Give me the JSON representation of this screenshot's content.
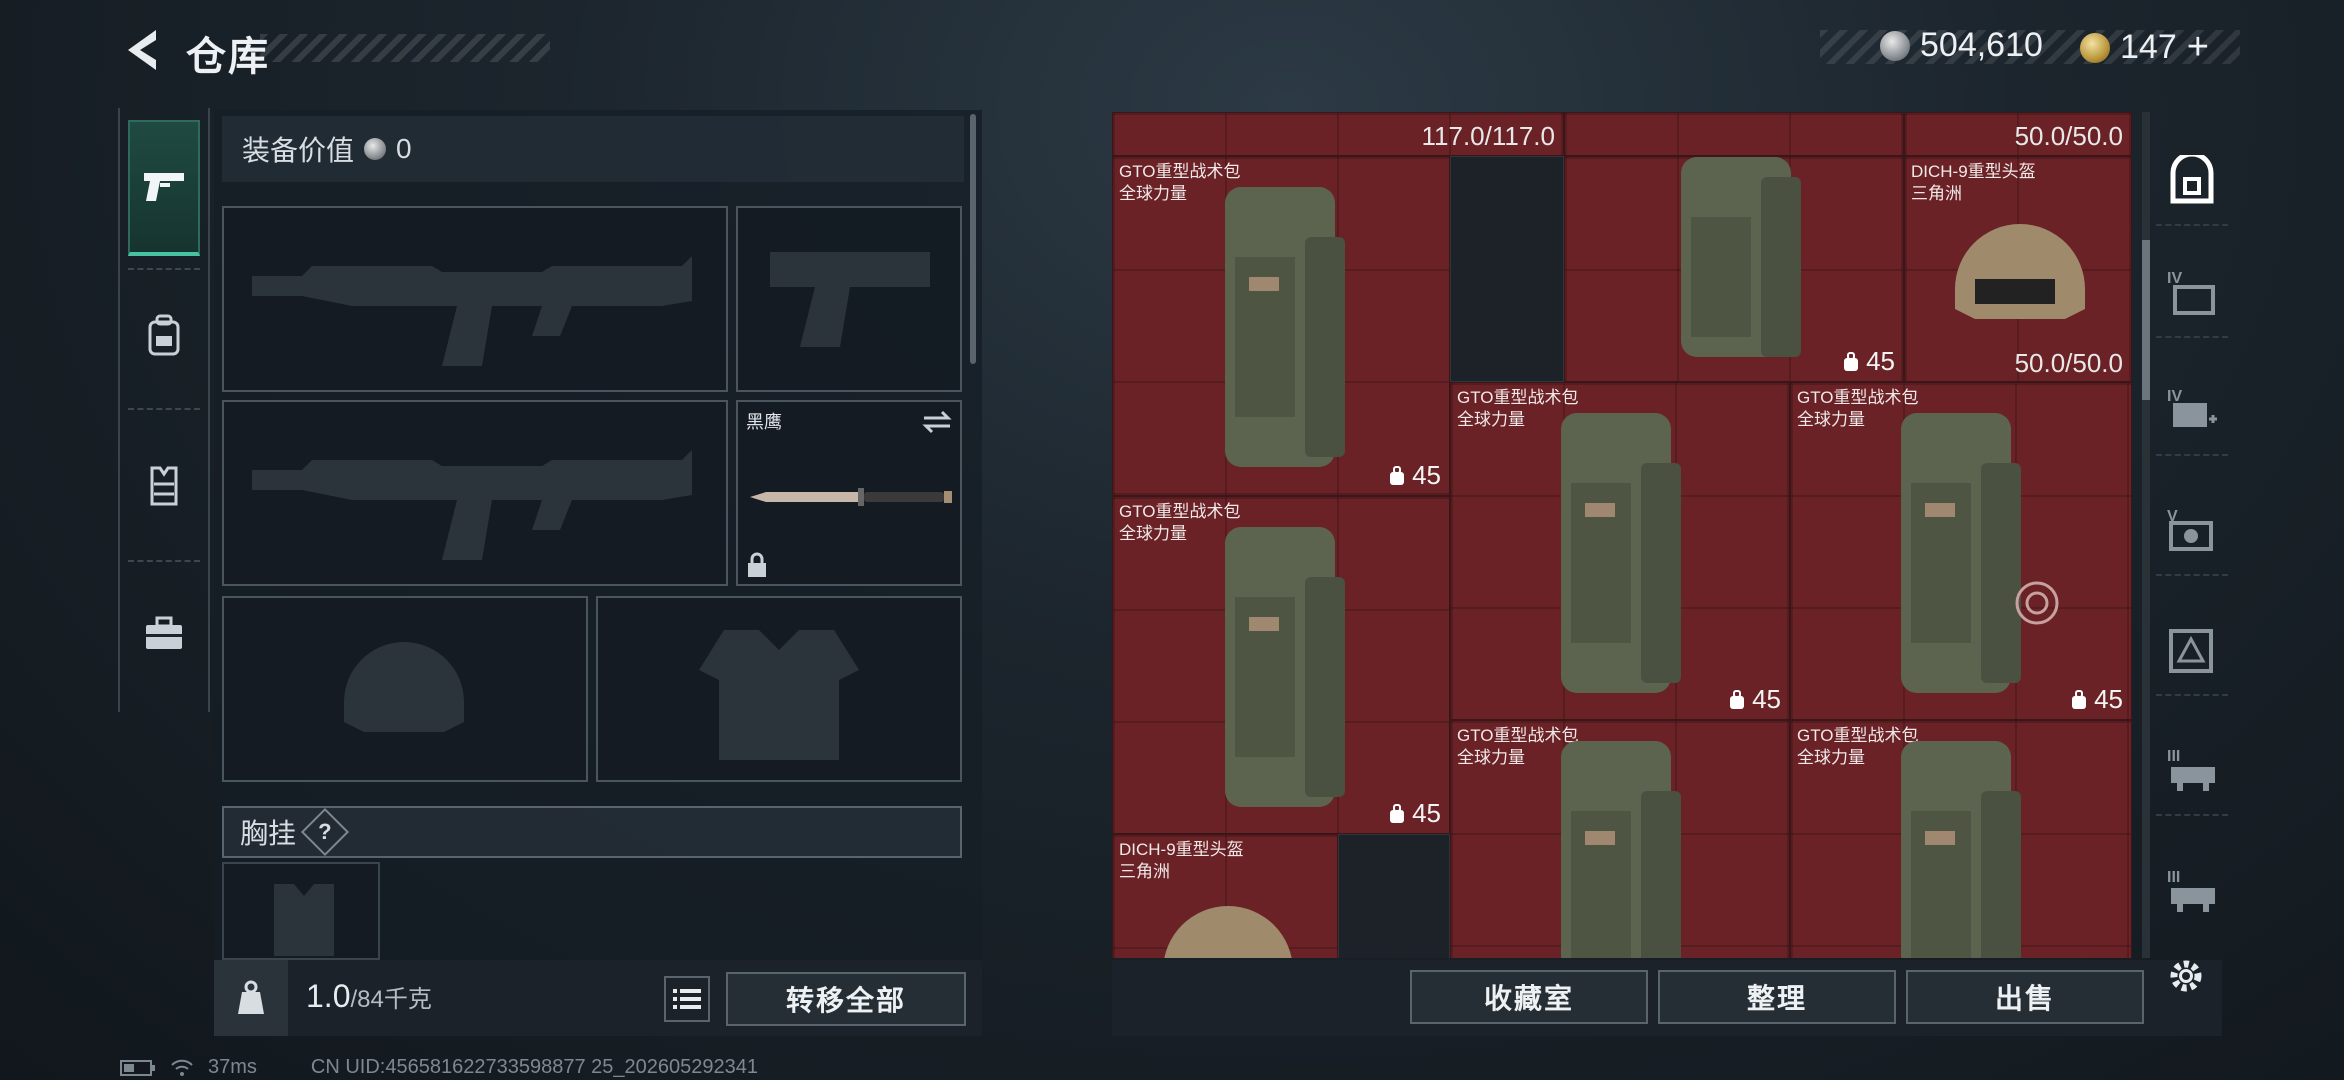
{
  "header": {
    "title": "仓库"
  },
  "currency": [
    {
      "icon": "silver-coin-icon",
      "value": "504,610"
    },
    {
      "icon": "gold-coin-icon",
      "value": "147",
      "suffix": "+"
    }
  ],
  "left_tabs": [
    {
      "icon": "pistol-icon",
      "active": true
    },
    {
      "icon": "backpack-icon",
      "active": false
    },
    {
      "icon": "vest-icon",
      "active": false
    },
    {
      "icon": "toolbox-icon",
      "active": false
    }
  ],
  "equipment": {
    "value_label": "装备价值",
    "value": "0",
    "melee_name": "黑鹰",
    "chest_label": "胸挂",
    "chest_help": "?"
  },
  "footer_left": {
    "weight_current": "1.0",
    "weight_max": "/84千克",
    "transfer_all": "转移全部"
  },
  "grid": {
    "top_durability_a": "117.0/117.0",
    "top_durability_b": "50.0/50.0",
    "items": [
      {
        "name": "GTO重型战术包",
        "sub": "全球力量",
        "qty": "45"
      },
      {
        "name": "DICH-9重型头盔",
        "sub": "三角洲",
        "dur": "50.0/50.0"
      },
      {
        "name": "GTO重型战术包",
        "sub": "全球力量",
        "qty": "45"
      },
      {
        "name": "GTO重型战术包",
        "sub": "全球力量",
        "qty": "45"
      },
      {
        "name": "GTO重型战术包",
        "sub": "全球力量",
        "qty": "45"
      },
      {
        "name": "GTO重型战术包",
        "sub": "全球力量",
        "qty": ""
      },
      {
        "name": "GTO重型战术包",
        "sub": "全球力量",
        "qty": ""
      },
      {
        "name": "DICH-9重型头盔",
        "sub": "三角洲"
      }
    ],
    "top_right_qty": "45"
  },
  "footer_right": {
    "collection": "收藏室",
    "organize": "整理",
    "sell": "出售"
  },
  "right_rail": [
    {
      "icon": "safe-box-icon",
      "label": ""
    },
    {
      "icon": "folder-tier-icon",
      "label": "IV"
    },
    {
      "icon": "medkit-tier-icon",
      "label": "IV"
    },
    {
      "icon": "ammo-tier-icon",
      "label": "V"
    },
    {
      "icon": "warning-crate-icon",
      "label": ""
    },
    {
      "icon": "rack-tier-icon",
      "label": "III"
    },
    {
      "icon": "rack-tier-icon-2",
      "label": "III"
    }
  ],
  "status": {
    "ping": "37ms",
    "uid": "CN UID:456581622733598877 25_202605292341"
  }
}
